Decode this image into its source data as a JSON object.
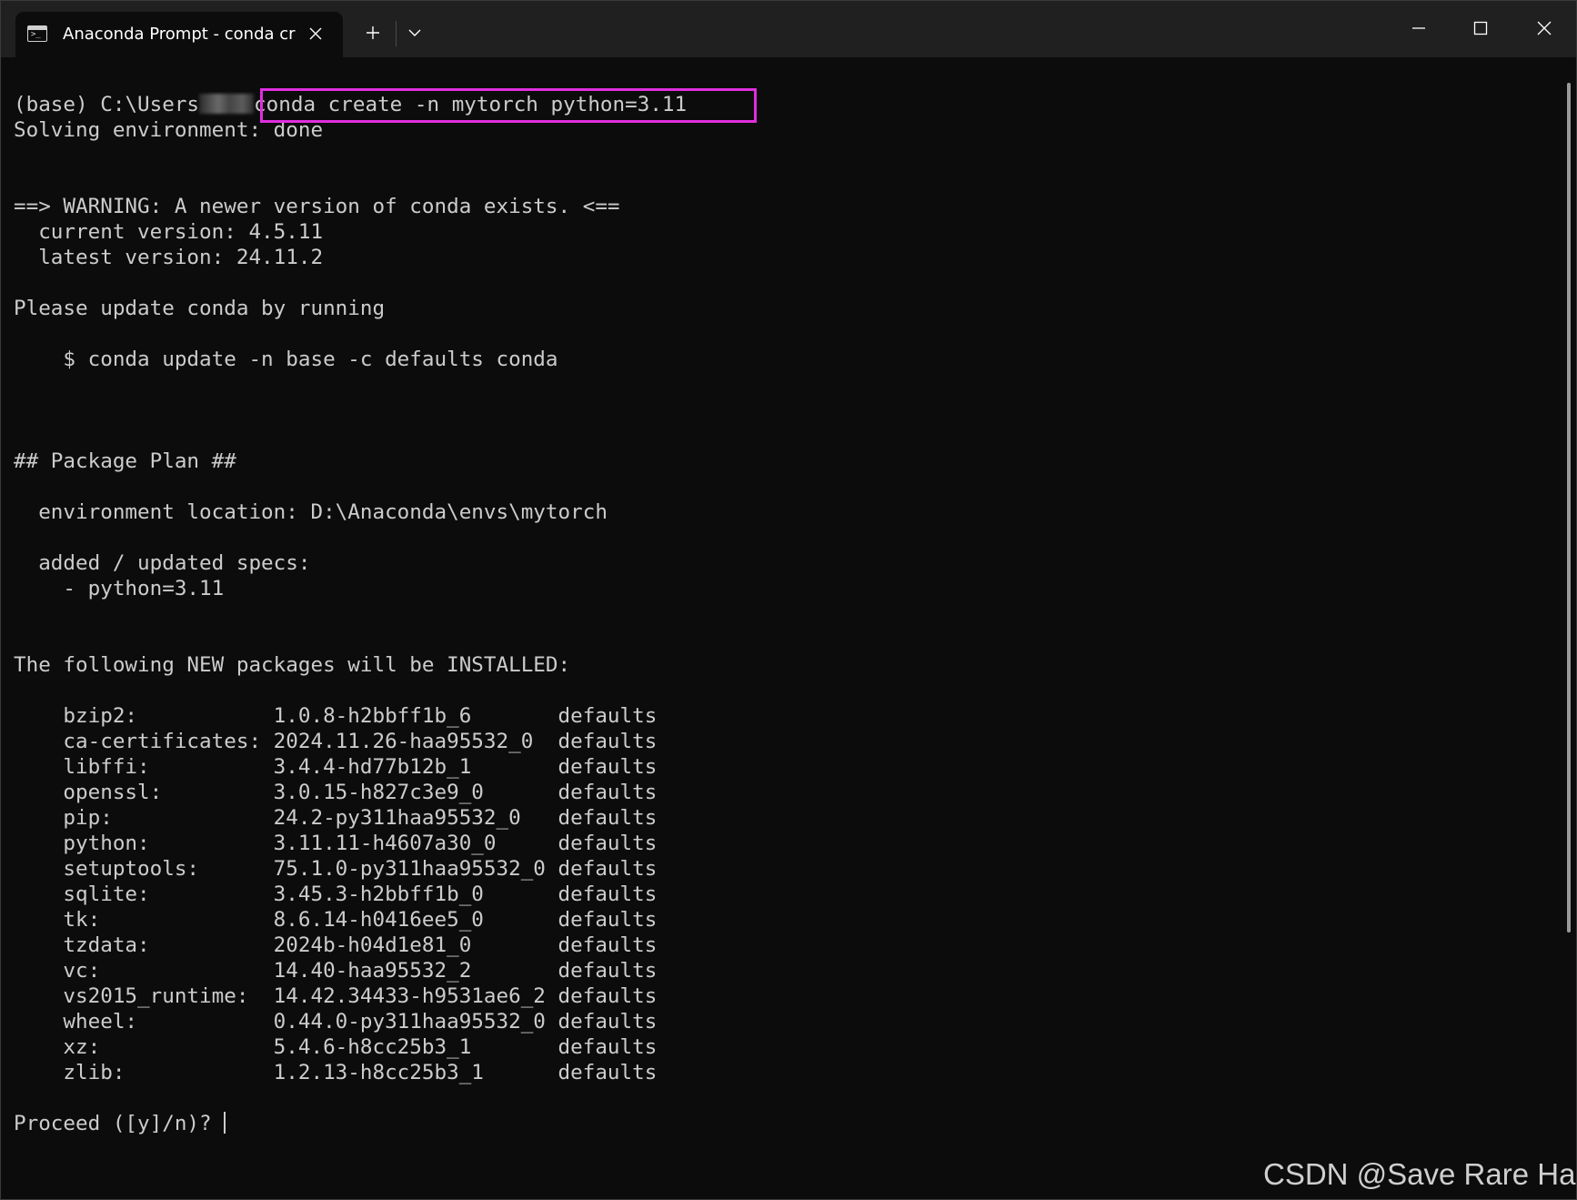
{
  "window": {
    "tab_title": "Anaconda Prompt - conda  cr"
  },
  "terminal": {
    "prompt_prefix": "(base) C:\\Users",
    "command_rest": "conda create -n mytorch python=3.11",
    "lines_after": [
      "Solving environment: done",
      "",
      "",
      "==> WARNING: A newer version of conda exists. <==",
      "  current version: 4.5.11",
      "  latest version: 24.11.2",
      "",
      "Please update conda by running",
      "",
      "    $ conda update -n base -c defaults conda",
      "",
      "",
      "",
      "## Package Plan ##",
      "",
      "  environment location: D:\\Anaconda\\envs\\mytorch",
      "",
      "  added / updated specs:",
      "    - python=3.11",
      "",
      "",
      "The following NEW packages will be INSTALLED:",
      "",
      "    bzip2:           1.0.8-h2bbff1b_6       defaults",
      "    ca-certificates: 2024.11.26-haa95532_0  defaults",
      "    libffi:          3.4.4-hd77b12b_1       defaults",
      "    openssl:         3.0.15-h827c3e9_0      defaults",
      "    pip:             24.2-py311haa95532_0   defaults",
      "    python:          3.11.11-h4607a30_0     defaults",
      "    setuptools:      75.1.0-py311haa95532_0 defaults",
      "    sqlite:          3.45.3-h2bbff1b_0      defaults",
      "    tk:              8.6.14-h0416ee5_0      defaults",
      "    tzdata:          2024b-h04d1e81_0       defaults",
      "    vc:              14.40-haa95532_2       defaults",
      "    vs2015_runtime:  14.42.34433-h9531ae6_2 defaults",
      "    wheel:           0.44.0-py311haa95532_0 defaults",
      "    xz:              5.4.6-h8cc25b3_1       defaults",
      "    zlib:            1.2.13-h8cc25b3_1      defaults",
      ""
    ],
    "final_prompt": "Proceed ([y]/n)? "
  },
  "watermark": "CSDN @Save Rare Hair",
  "colors": {
    "background": "#0c0c0c",
    "foreground": "#cccccc",
    "highlight": "#e02ee0",
    "titlebar": "#202020"
  },
  "icons": {
    "tab": "terminal-icon",
    "close_tab": "close-icon",
    "new_tab": "plus-icon",
    "dropdown": "chevron-down-icon",
    "minimize": "minimize-icon",
    "maximize": "maximize-icon",
    "close_window": "close-icon"
  }
}
